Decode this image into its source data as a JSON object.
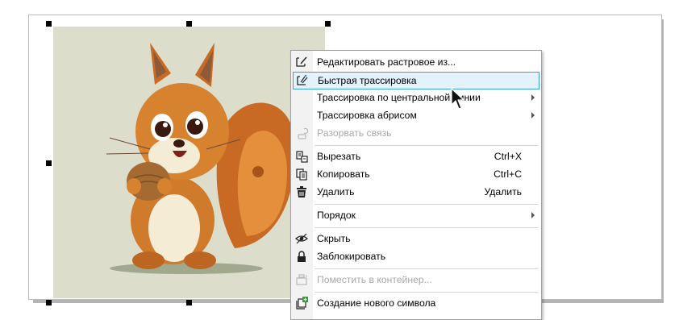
{
  "context_menu": {
    "items": [
      {
        "label": "Редактировать растровое из...",
        "shortcut": "",
        "icon": "edit-bitmap-icon",
        "has_submenu": false,
        "enabled": true,
        "highlighted": false
      },
      {
        "label": "Быстрая трассировка",
        "shortcut": "",
        "icon": "quick-trace-icon",
        "has_submenu": false,
        "enabled": true,
        "highlighted": true
      },
      {
        "label": "Трассировка по центральной линии",
        "shortcut": "",
        "icon": "",
        "has_submenu": true,
        "enabled": true,
        "highlighted": false
      },
      {
        "label": "Трассировка абрисом",
        "shortcut": "",
        "icon": "",
        "has_submenu": true,
        "enabled": true,
        "highlighted": false
      },
      {
        "label": "Разорвать связь",
        "shortcut": "",
        "icon": "break-link-icon",
        "has_submenu": false,
        "enabled": false,
        "highlighted": false
      },
      {
        "label": "Вырезать",
        "shortcut": "Ctrl+X",
        "icon": "cut-icon",
        "has_submenu": false,
        "enabled": true,
        "highlighted": false
      },
      {
        "label": "Копировать",
        "shortcut": "Ctrl+C",
        "icon": "copy-icon",
        "has_submenu": false,
        "enabled": true,
        "highlighted": false
      },
      {
        "label": "Удалить",
        "shortcut": "Удалить",
        "icon": "trash-icon",
        "has_submenu": false,
        "enabled": true,
        "highlighted": false
      },
      {
        "label": "Порядок",
        "shortcut": "",
        "icon": "",
        "has_submenu": true,
        "enabled": true,
        "highlighted": false
      },
      {
        "label": "Скрыть",
        "shortcut": "",
        "icon": "eye-icon",
        "has_submenu": false,
        "enabled": true,
        "highlighted": false
      },
      {
        "label": "Заблокировать",
        "shortcut": "",
        "icon": "lock-icon",
        "has_submenu": false,
        "enabled": true,
        "highlighted": false
      },
      {
        "label": "Поместить в контейнер...",
        "shortcut": "",
        "icon": "powerclip-icon",
        "has_submenu": false,
        "enabled": false,
        "highlighted": false
      },
      {
        "label": "Создание нового символа",
        "shortcut": "",
        "icon": "new-symbol-icon",
        "has_submenu": false,
        "enabled": true,
        "highlighted": false
      }
    ]
  },
  "canvas": {
    "bitmap_subject": "squirrel-holding-nut",
    "selection_handles": 8,
    "colors": {
      "bitmap_background": "#dcdecb",
      "highlight_fill": "#e3f2fb",
      "highlight_border": "#36a3d4",
      "disabled_text": "#a7a7a7"
    }
  }
}
